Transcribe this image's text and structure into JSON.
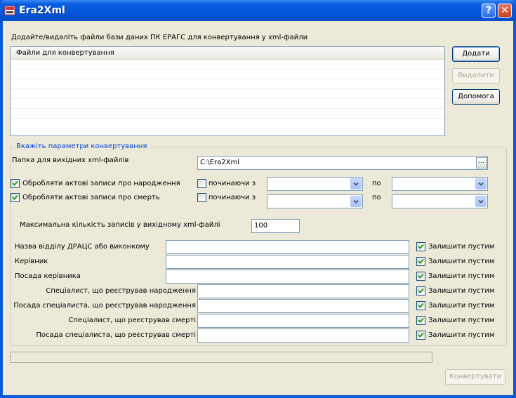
{
  "window": {
    "title": "Era2Xml",
    "help_glyph": "?",
    "close_glyph": "✕"
  },
  "instructions": "Додайте/видаліть файли бази даних ПК ЕРАГС для конвертування у xml-файли",
  "files_list": {
    "column_header": "Файли для конвертування",
    "rows": []
  },
  "buttons": {
    "add": "Додати",
    "remove": "Видалити",
    "help": "Допомога",
    "convert": "Конвертувати"
  },
  "params": {
    "group_title": "Вкажіть параметри конвертування",
    "output_folder_label": "Папка для вихідних xml-файлів",
    "output_folder_value": "C:\\Era2Xml",
    "browse_label": "...",
    "births": {
      "label": "Обробляти актові записи про народження",
      "checked": true,
      "from_label": "починаючи з",
      "from_checked": false,
      "to_label": "по",
      "from_value": "",
      "to_value": ""
    },
    "deaths": {
      "label": "Обробляти актові записи про смерть",
      "checked": true,
      "from_label": "починаючи з",
      "from_checked": false,
      "to_label": "по",
      "from_value": "",
      "to_value": ""
    },
    "max_records_label": "Максимальна кількість записів у вихідному xml-файлі",
    "max_records_value": "100",
    "leave_empty_label": "Залишити пустим",
    "fields": [
      {
        "label": "Назва відділу ДРАЦС або виконкому",
        "value": "",
        "leave_empty": true
      },
      {
        "label": "Керівник",
        "value": "",
        "leave_empty": true
      },
      {
        "label": "Посада керівника",
        "value": "",
        "leave_empty": true
      },
      {
        "label": "Спеціалист, що реєстрував народження",
        "value": "",
        "leave_empty": true
      },
      {
        "label": "Посада спеціалиста, що реєстрував народження",
        "value": "",
        "leave_empty": true
      },
      {
        "label": "Спеціалист, що реєстрував смерті",
        "value": "",
        "leave_empty": true
      },
      {
        "label": "Посада спеціалиста, що реєстрував смерті",
        "value": "",
        "leave_empty": true
      }
    ]
  },
  "progress": {
    "fraction": 0
  },
  "colors": {
    "title_bar": "#0455d9",
    "dialog_bg": "#ece9d8",
    "group_title": "#0046d5",
    "field_border": "#7f9db9"
  }
}
